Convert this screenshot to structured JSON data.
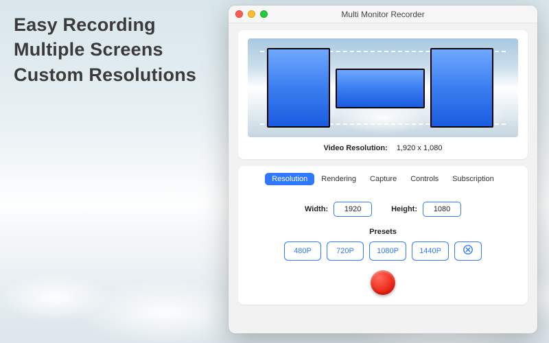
{
  "headline": {
    "line1": "Easy Recording",
    "line2": "Multiple Screens",
    "line3": "Custom Resolutions"
  },
  "window": {
    "title": "Multi Monitor Recorder"
  },
  "preview": {
    "res_label": "Video Resolution:",
    "res_value": "1,920 x 1,080"
  },
  "tabs": {
    "items": [
      {
        "label": "Resolution",
        "active": true
      },
      {
        "label": "Rendering",
        "active": false
      },
      {
        "label": "Capture",
        "active": false
      },
      {
        "label": "Controls",
        "active": false
      },
      {
        "label": "Subscription",
        "active": false
      }
    ]
  },
  "dimensions": {
    "width_label": "Width:",
    "width_value": "1920",
    "height_label": "Height:",
    "height_value": "1080"
  },
  "presets": {
    "title": "Presets",
    "buttons": [
      "480P",
      "720P",
      "1080P",
      "1440P"
    ],
    "clear_icon": "⊗"
  }
}
